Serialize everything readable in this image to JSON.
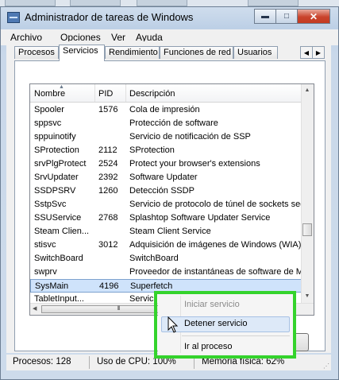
{
  "window": {
    "title": "Administrador de tareas de Windows",
    "minimize_glyph": "▬",
    "maximize_glyph": "□",
    "close_glyph": "✕"
  },
  "menu": [
    "Archivo",
    "Opciones",
    "Ver",
    "Ayuda"
  ],
  "tabs": [
    {
      "label": "Procesos",
      "active": false
    },
    {
      "label": "Servicios",
      "active": true
    },
    {
      "label": "Rendimiento",
      "active": false
    },
    {
      "label": "Funciones de red",
      "active": false
    },
    {
      "label": "Usuarios",
      "active": false
    }
  ],
  "tab_scroll": {
    "left": "◀",
    "right": "▶"
  },
  "columns": {
    "name": "Nombre",
    "pid": "PID",
    "desc": "Descripción"
  },
  "rows": [
    {
      "name": "Spooler",
      "pid": "1576",
      "desc": "Cola de impresión"
    },
    {
      "name": "sppsvc",
      "pid": "",
      "desc": "Protección de software"
    },
    {
      "name": "sppuinotify",
      "pid": "",
      "desc": "Servicio de notificación de SSP"
    },
    {
      "name": "SProtection",
      "pid": "2112",
      "desc": "SProtection"
    },
    {
      "name": "srvPlgProtect",
      "pid": "2524",
      "desc": "Protect your browser's extensions"
    },
    {
      "name": "SrvUpdater",
      "pid": "2392",
      "desc": "Software Updater"
    },
    {
      "name": "SSDPSRV",
      "pid": "1260",
      "desc": "Detección SSDP"
    },
    {
      "name": "SstpSvc",
      "pid": "",
      "desc": "Servicio de protocolo de túnel de sockets seg"
    },
    {
      "name": "SSUService",
      "pid": "2768",
      "desc": "Splashtop Software Updater Service"
    },
    {
      "name": "Steam Clien...",
      "pid": "",
      "desc": "Steam Client Service"
    },
    {
      "name": "stisvc",
      "pid": "3012",
      "desc": "Adquisición de imágenes de Windows (WIA)"
    },
    {
      "name": "SwitchBoard",
      "pid": "",
      "desc": "SwitchBoard"
    },
    {
      "name": "swprv",
      "pid": "",
      "desc": "Proveedor de instantáneas de software de M"
    },
    {
      "name": "SysMain",
      "pid": "4196",
      "desc": "Superfetch",
      "selected": true
    },
    {
      "name": "TabletInput...",
      "pid": "",
      "desc": "Servici"
    }
  ],
  "context_menu": {
    "start": "Iniciar servicio",
    "stop": "Detener servicio",
    "goto": "Ir al proceso"
  },
  "status": {
    "processes": "Procesos: 128",
    "cpu": "Uso de CPU: 100%",
    "memory": "Memoria física: 62%"
  },
  "colors": {
    "highlight_frame": "#34d32c",
    "selection": "#cfe3fb",
    "close_button": "#c9432c"
  }
}
